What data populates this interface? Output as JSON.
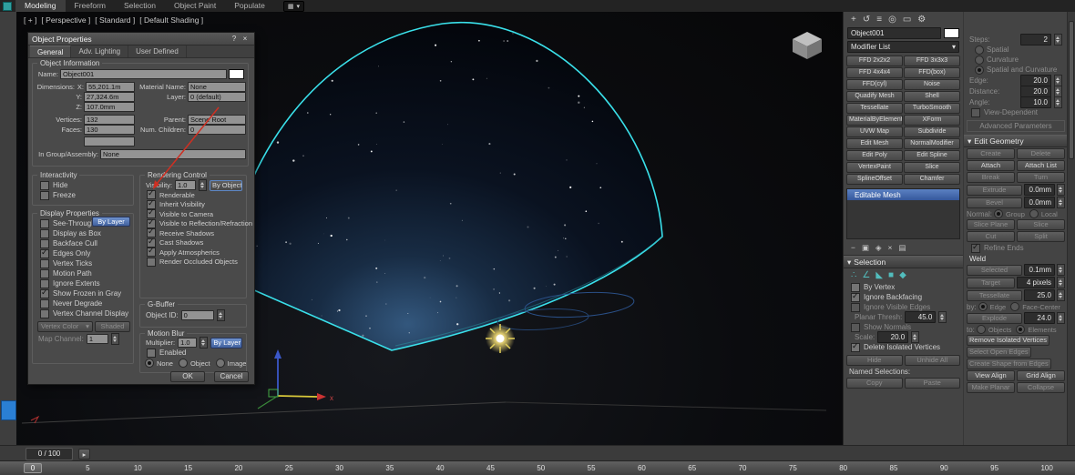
{
  "icons": {
    "create": "+",
    "modify": "↺",
    "hierarchy": "≡",
    "motion": "◎",
    "display": "▭",
    "utilities": "⚙",
    "pin": "−",
    "show_end_result": "▣",
    "make_unique": "◈",
    "remove_modifier": "×",
    "configure_sets": "▤",
    "caret_down": "▾",
    "help": "?",
    "close": "×",
    "next": "▸",
    "ribbon_grid": "▦"
  },
  "ribbon": {
    "tabs": [
      {
        "label": "Modeling",
        "active": true
      },
      {
        "label": "Freeform"
      },
      {
        "label": "Selection"
      },
      {
        "label": "Object Paint"
      },
      {
        "label": "Populate"
      }
    ]
  },
  "viewport": {
    "labels": [
      {
        "label": "[ + ]"
      },
      {
        "label": "[ Perspective ]"
      },
      {
        "label": "[ Standard ]"
      },
      {
        "label": "[ Default Shading ]"
      }
    ]
  },
  "scene": {
    "colors": {
      "outline": "#3ae0ea",
      "glow": "#33577d",
      "sun": "#ffe87a",
      "axis_x": "#cc3333",
      "axis_y": "#44aa44",
      "axis_z": "#3a57c8"
    }
  },
  "dialog": {
    "title": "Object Properties",
    "tabs": [
      {
        "label": "General",
        "active": true
      },
      {
        "label": "Adv. Lighting"
      },
      {
        "label": "User Defined"
      }
    ],
    "object_information": {
      "title": "Object Information",
      "name_label": "Name:",
      "name_value": "Object001",
      "dimensions_label": "Dimensions:",
      "x_label": "X:",
      "x_value": "55,201.1m",
      "y_label": "Y:",
      "y_value": "27,324.6m",
      "z_label": "Z:",
      "z_value": "107.0mm",
      "material_label": "Material Name:",
      "material_value": "None",
      "layer_label": "Layer:",
      "layer_value": "0 (default)",
      "vertices_label": "Vertices:",
      "vertices_value": "132",
      "faces_label": "Faces:",
      "faces_value": "130",
      "parent_label": "Parent:",
      "parent_value": "Scene Root",
      "children_label": "Num. Children:",
      "children_value": "0",
      "group_label": "In Group/Assembly:",
      "group_value": "None"
    },
    "interactivity": {
      "title": "Interactivity",
      "items": [
        {
          "label": "Hide"
        },
        {
          "label": "Freeze"
        }
      ]
    },
    "display_properties": {
      "title": "Display Properties",
      "see_through_label": "See-Through",
      "by_layer_button": "By Layer",
      "items": [
        {
          "label": "Display as Box"
        },
        {
          "label": "Backface Cull"
        },
        {
          "label": "Edges Only",
          "checked": true
        },
        {
          "label": "Vertex Ticks"
        },
        {
          "label": "Motion Path"
        },
        {
          "label": "Ignore Extents"
        },
        {
          "label": "Show Frozen in Gray",
          "checked": true
        },
        {
          "label": "Never Degrade"
        },
        {
          "label": "Vertex Channel Display"
        }
      ],
      "vertex_color_dropdown": "Vertex Color",
      "shaded_button": "Shaded",
      "map_channel_label": "Map Channel:",
      "map_channel_value": "1"
    },
    "rendering_control": {
      "title": "Rendering Control",
      "visibility_label": "Visibility:",
      "visibility_value": "1.0",
      "by_object_button": "By Object",
      "items": [
        {
          "label": "Renderable",
          "checked": true
        },
        {
          "label": "Inherit Visibility",
          "checked": true
        },
        {
          "label": "Visible to Camera",
          "checked": true
        },
        {
          "label": "Visible to Reflection/Refraction",
          "checked": true
        },
        {
          "label": "Receive Shadows",
          "checked": true
        },
        {
          "label": "Cast Shadows",
          "checked": true
        },
        {
          "label": "Apply Atmospherics",
          "checked": true
        },
        {
          "label": "Render Occluded Objects"
        }
      ]
    },
    "g_buffer": {
      "title": "G-Buffer",
      "object_id_label": "Object ID:",
      "object_id_value": "0"
    },
    "motion_blur": {
      "title": "Motion Blur",
      "multiplier_label": "Multiplier:",
      "multiplier_value": "1.0",
      "by_layer_button": "By Layer",
      "enabled_label": "Enabled",
      "options": [
        {
          "label": "None",
          "selected": true
        },
        {
          "label": "Object"
        },
        {
          "label": "Image"
        }
      ]
    },
    "ok_button": "OK",
    "cancel_button": "Cancel"
  },
  "command_panel": {
    "object_name": "Object001",
    "modifier_list_label": "Modifier List",
    "modifier_buttons": [
      "FFD 2x2x2",
      "FFD 3x3x3",
      "FFD 4x4x4",
      "FFD(box)",
      "FFD(cyl)",
      "Noise",
      "Quadify Mesh",
      "Shell",
      "Tessellate",
      "TurboSmooth",
      "MaterialByElement",
      "XForm",
      "UVW Map",
      "Subdivide",
      "Edit Mesh",
      "NormalModifier",
      "Edit Poly",
      "Edit Spline",
      "VertexPaint",
      "Slice",
      "SplineOffset",
      "Chamfer"
    ],
    "stack": [
      {
        "label": "Editable Mesh",
        "selected": true
      }
    ],
    "selection": {
      "title": "Selection",
      "icons": [
        {
          "name": "vertex",
          "glyph": "∴"
        },
        {
          "name": "edge",
          "glyph": "∠"
        },
        {
          "name": "face",
          "glyph": "◣"
        },
        {
          "name": "polygon",
          "glyph": "■"
        },
        {
          "name": "element",
          "glyph": "◆"
        }
      ],
      "checkboxes": [
        {
          "label": "By Vertex"
        },
        {
          "label": "Ignore Backfacing",
          "checked": true
        },
        {
          "label": "Ignore Visible Edges",
          "disabled": true
        }
      ],
      "planar_label": "Planar Thresh:",
      "planar_value": "45.0",
      "show_normals_label": "Show Normals",
      "scale_label": "Scale:",
      "scale_value": "20.0",
      "delete_isolated_label": "Delete Isolated Vertices",
      "hide_button": "Hide",
      "unhide_button": "Unhide All",
      "named_selections_label": "Named Selections:",
      "copy_button": "Copy",
      "paste_button": "Paste"
    }
  },
  "right_panel": {
    "steps_label": "Steps:",
    "steps_value": "2",
    "options": [
      {
        "label": "Spatial"
      },
      {
        "label": "Curvature"
      },
      {
        "label": "Spatial and Curvature",
        "selected": true
      }
    ],
    "edge_label": "Edge:",
    "edge_value": "20.0",
    "distance_label": "Distance:",
    "distance_value": "20.0",
    "angle_label": "Angle:",
    "angle_value": "10.0",
    "view_dependent_label": "View-Dependent",
    "advanced_parameters_label": "Advanced Parameters",
    "edit_geometry": {
      "title": "Edit Geometry",
      "create_button": "Create",
      "delete_button": "Delete",
      "attach_button": "Attach",
      "attach_list_button": "Attach List",
      "break_button": "Break",
      "turn_button": "Turn",
      "extrude_button": "Extrude",
      "extrude_value": "0.0mm",
      "bevel_button": "Bevel",
      "bevel_value": "0.0mm",
      "normal_label": "Normal:",
      "normal_options": [
        {
          "label": "Group",
          "selected": true,
          "disabled": true
        },
        {
          "label": "Local",
          "disabled": true
        }
      ],
      "slice_plane_button": "Slice Plane",
      "slice_button": "Slice",
      "cut_button": "Cut",
      "split_button": "Split",
      "refine_ends_label": "Refine Ends",
      "weld_label": "Weld",
      "weld_selected_button": "Selected",
      "weld_selected_value": "0.1mm",
      "weld_target_button": "Target",
      "weld_target_value": "4 pixels",
      "tessellate_button": "Tessellate",
      "tessellate_value": "25.0",
      "by_label": "by:",
      "by_options": [
        {
          "label": "Edge",
          "selected": true,
          "disabled": true
        },
        {
          "label": "Face-Center",
          "disabled": true
        }
      ],
      "explode_button": "Explode",
      "explode_value": "24.0",
      "to_label": "to:",
      "to_options": [
        {
          "label": "Objects",
          "disabled": true
        },
        {
          "label": "Elements",
          "selected": true,
          "disabled": true
        }
      ],
      "remove_isolated_button": "Remove Isolated Vertices",
      "select_open_button": "Select Open Edges",
      "create_shape_button": "Create Shape from Edges",
      "view_align_button": "View Align",
      "grid_align_button": "Grid Align",
      "make_planar_button": "Make Planar",
      "collapse_button": "Collapse"
    }
  },
  "timeline": {
    "frame_display": "0 / 100",
    "ticks": [
      "0",
      "5",
      "10",
      "15",
      "20",
      "25",
      "30",
      "35",
      "40",
      "45",
      "50",
      "55",
      "60",
      "65",
      "70",
      "75",
      "80",
      "85",
      "90",
      "95",
      "100"
    ]
  }
}
